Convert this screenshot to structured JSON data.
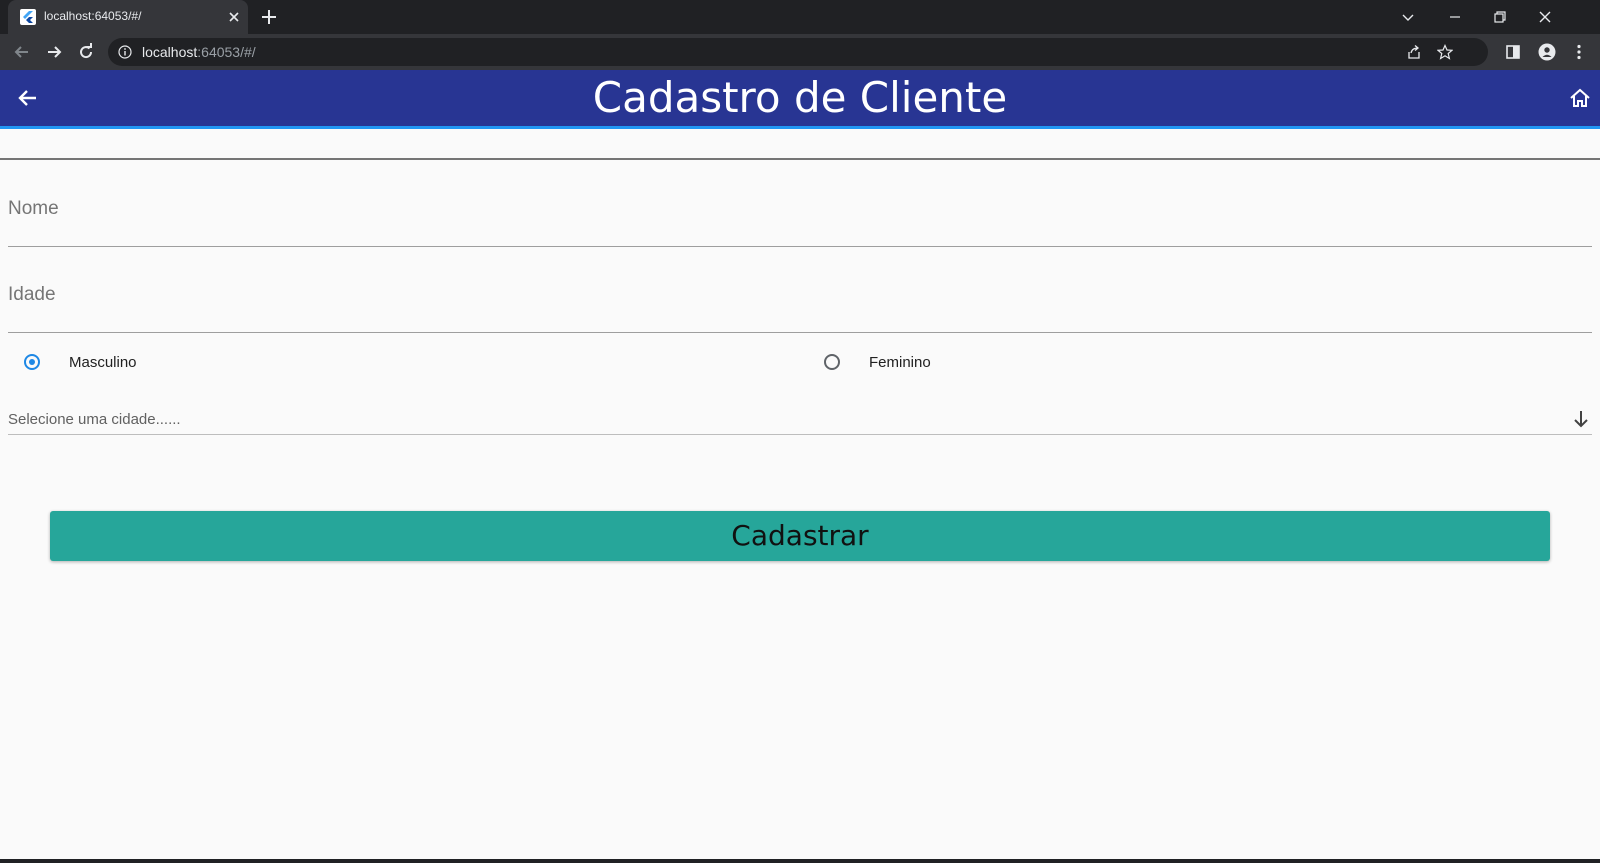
{
  "browser": {
    "tab_title": "localhost:64053/#/",
    "url_host": "localhost",
    "url_rest": ":64053/#/",
    "icons": [
      "flutter-favicon",
      "close-icon",
      "plus-icon",
      "chevron-down-icon",
      "minimize-icon",
      "restore-icon",
      "back-arrow-icon",
      "forward-arrow-icon",
      "reload-icon",
      "info-icon",
      "share-icon",
      "star-icon",
      "side-panel-icon",
      "profile-icon",
      "kebab-menu-icon"
    ]
  },
  "appbar": {
    "title": "Cadastro de Cliente",
    "background": "#283593",
    "accent": "#2196f3",
    "icons": [
      "arrow-back-icon",
      "home-icon"
    ]
  },
  "form": {
    "name_label": "Nome",
    "age_label": "Idade",
    "gender_options": [
      {
        "label": "Masculino",
        "selected": true
      },
      {
        "label": "Feminino",
        "selected": false
      }
    ],
    "city_hint": "Selecione uma cidade......",
    "submit_label": "Cadastrar",
    "submit_color": "#26a69a"
  }
}
